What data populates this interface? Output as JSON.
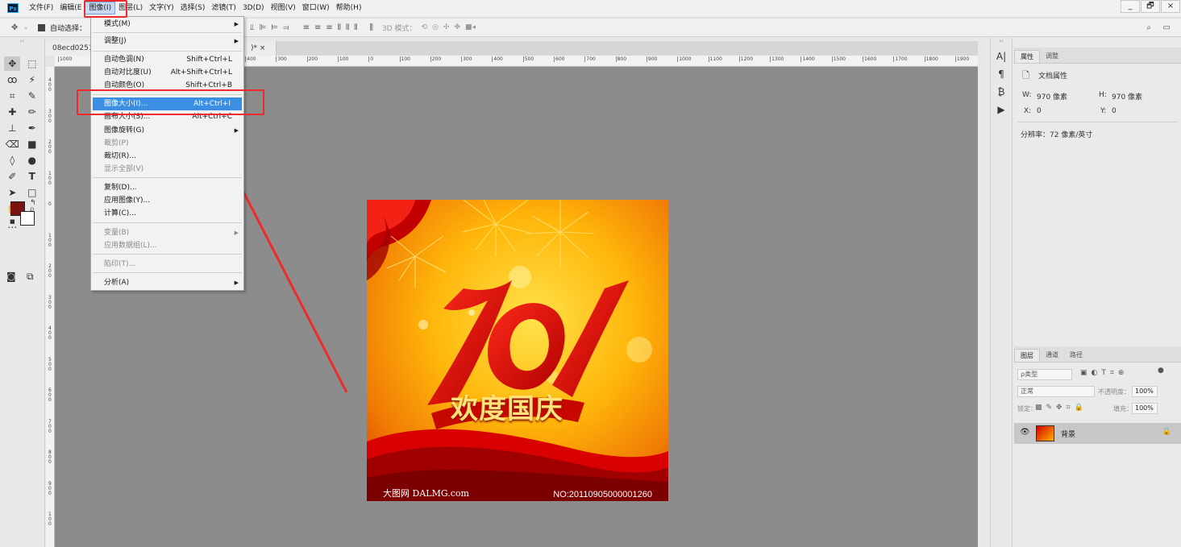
{
  "app": {
    "logo": "Ps"
  },
  "menubar": {
    "items": [
      "文件(F)",
      "编辑(E",
      "图像(I)",
      "图层(L)",
      "文字(Y)",
      "选择(S)",
      "滤镜(T)",
      "3D(D)",
      "视图(V)",
      "窗口(W)",
      "帮助(H)"
    ],
    "active_index": 2
  },
  "window": {
    "minimize": "_",
    "restore": "🗗",
    "close": "×"
  },
  "options": {
    "auto_select_label": "自动选择：",
    "mode3d_label": "3D 模式："
  },
  "document": {
    "tab_label": "08ecd0251",
    "tab_suffix": ")* ×"
  },
  "rulers": {
    "h_ticks": [
      "1000",
      "400",
      "300",
      "200",
      "100",
      "0",
      "100",
      "200",
      "300",
      "400",
      "500",
      "600",
      "700",
      "800",
      "900",
      "1000",
      "1100",
      "1200",
      "1300",
      "1400",
      "1500",
      "1600",
      "1700",
      "1800",
      "1900"
    ],
    "v_ticks": [
      "4\n0\n0",
      "3\n0\n0",
      "2\n0\n0",
      "1\n0\n0",
      "0",
      "1\n0\n0",
      "2\n0\n0",
      "3\n0\n0",
      "4\n0\n0",
      "5\n0\n0",
      "6\n0\n0",
      "7\n0\n0",
      "8\n0\n0",
      "9\n0\n0",
      "1\n0\n0"
    ]
  },
  "image_menu": {
    "items": [
      {
        "label": "模式(M)",
        "shortcut": "",
        "submenu": true,
        "disabled": false
      },
      {
        "label": "调整(J)",
        "shortcut": "",
        "submenu": true,
        "disabled": false
      },
      {
        "label": "自动色调(N)",
        "shortcut": "Shift+Ctrl+L",
        "submenu": false,
        "disabled": false
      },
      {
        "label": "自动对比度(U)",
        "shortcut": "Alt+Shift+Ctrl+L",
        "submenu": false,
        "disabled": false
      },
      {
        "label": "自动颜色(O)",
        "shortcut": "Shift+Ctrl+B",
        "submenu": false,
        "disabled": false
      },
      {
        "label": "图像大小(I)...",
        "shortcut": "Alt+Ctrl+I",
        "submenu": false,
        "disabled": false,
        "highlighted": true
      },
      {
        "label": "画布大小(S)...",
        "shortcut": "Alt+Ctrl+C",
        "submenu": false,
        "disabled": false
      },
      {
        "label": "图像旋转(G)",
        "shortcut": "",
        "submenu": true,
        "disabled": false
      },
      {
        "label": "裁剪(P)",
        "shortcut": "",
        "submenu": false,
        "disabled": true
      },
      {
        "label": "裁切(R)...",
        "shortcut": "",
        "submenu": false,
        "disabled": false
      },
      {
        "label": "显示全部(V)",
        "shortcut": "",
        "submenu": false,
        "disabled": true
      },
      {
        "label": "复制(D)...",
        "shortcut": "",
        "submenu": false,
        "disabled": false
      },
      {
        "label": "应用图像(Y)...",
        "shortcut": "",
        "submenu": false,
        "disabled": false
      },
      {
        "label": "计算(C)...",
        "shortcut": "",
        "submenu": false,
        "disabled": false
      },
      {
        "label": "变量(B)",
        "shortcut": "",
        "submenu": true,
        "disabled": true
      },
      {
        "label": "应用数据组(L)...",
        "shortcut": "",
        "submenu": false,
        "disabled": true
      },
      {
        "label": "陷印(T)...",
        "shortcut": "",
        "submenu": false,
        "disabled": true
      },
      {
        "label": "分析(A)",
        "shortcut": "",
        "submenu": true,
        "disabled": false
      }
    ]
  },
  "artwork": {
    "title": "欢度国庆",
    "watermark_left": "大图网 DALMG.com",
    "watermark_right": "NO:20110905000001260"
  },
  "properties_panel": {
    "tabs": [
      "属性",
      "调整"
    ],
    "section_title": "文档属性",
    "w_label": "W:",
    "w_value": "970 像素",
    "h_label": "H:",
    "h_value": "970 像素",
    "x_label": "X:",
    "x_value": "0",
    "y_label": "Y:",
    "y_value": "0",
    "resolution": "分辨率：72 像素/英寸"
  },
  "layers_panel": {
    "tabs": [
      "图层",
      "通道",
      "路径"
    ],
    "filter_placeholder": "ρ类型",
    "blend_mode": "正常",
    "opacity_label": "不透明度：",
    "opacity_value": "100%",
    "lock_label": "锁定：",
    "fill_label": "填充：",
    "fill_value": "100%",
    "layers": [
      {
        "name": "背景",
        "visible": true,
        "locked": true
      }
    ]
  },
  "colors": {
    "foreground": "#7a1212",
    "background": "#ffffff",
    "highlight": "#3b8fe3",
    "annotation": "#ee2b2b"
  }
}
